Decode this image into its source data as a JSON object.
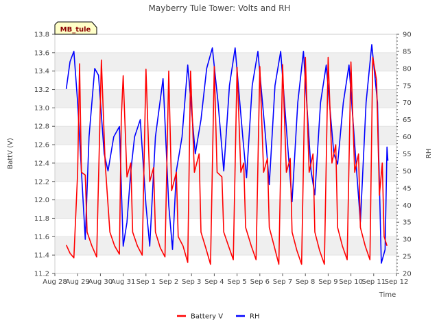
{
  "chart_data": {
    "type": "line",
    "title": "Mayberry Tule Tower: Volts and RH",
    "badge": "MB_tule",
    "xlabel": "Time",
    "ylabel_left": "BattV (V)",
    "ylabel_right": "RH",
    "xlim": [
      "2023-08-28",
      "2023-09-12"
    ],
    "x_tick_labels": [
      "Aug 28",
      "Aug 29",
      "Aug 30",
      "Aug 31",
      "Sep 1",
      "Sep 2",
      "Sep 3",
      "Sep 4",
      "Sep 5",
      "Sep 6",
      "Sep 7",
      "Sep 8",
      "Sep 9",
      "Sep 10",
      "Sep 11",
      "Sep 12"
    ],
    "ylim_left": [
      11.2,
      13.8
    ],
    "y_ticks_left": [
      "11.2",
      "11.4",
      "11.6",
      "11.8",
      "12.0",
      "12.2",
      "12.4",
      "12.6",
      "12.8",
      "13.0",
      "13.2",
      "13.4",
      "13.6",
      "13.8"
    ],
    "ylim_right": [
      20,
      90
    ],
    "y_ticks_right": [
      "20",
      "25",
      "30",
      "35",
      "40",
      "45",
      "50",
      "55",
      "60",
      "65",
      "70",
      "75",
      "80",
      "85",
      "90"
    ],
    "grid": "horizontal bands",
    "legend_position": "bottom-center",
    "series": [
      {
        "name": "Battery V",
        "color": "#ff0000",
        "axis": "left",
        "points": [
          [
            "2023-08-28 12:00",
            11.51
          ],
          [
            "2023-08-28 16:00",
            11.42
          ],
          [
            "2023-08-28 20:00",
            11.37
          ],
          [
            "2023-08-29 00:00",
            12.3
          ],
          [
            "2023-08-29 02:00",
            13.48
          ],
          [
            "2023-08-29 04:00",
            12.3
          ],
          [
            "2023-08-29 08:00",
            12.27
          ],
          [
            "2023-08-29 10:00",
            11.65
          ],
          [
            "2023-08-29 15:00",
            11.5
          ],
          [
            "2023-08-29 20:00",
            11.38
          ],
          [
            "2023-08-29 23:00",
            12.64
          ],
          [
            "2023-08-30 01:00",
            13.52
          ],
          [
            "2023-08-30 05:00",
            12.4
          ],
          [
            "2023-08-30 10:00",
            11.65
          ],
          [
            "2023-08-30 15:00",
            11.5
          ],
          [
            "2023-08-30 20:00",
            11.41
          ],
          [
            "2023-08-30 22:00",
            12.88
          ],
          [
            "2023-08-31 00:00",
            13.35
          ],
          [
            "2023-08-31 04:00",
            12.25
          ],
          [
            "2023-08-31 08:00",
            12.4
          ],
          [
            "2023-08-31 10:00",
            11.65
          ],
          [
            "2023-08-31 15:00",
            11.5
          ],
          [
            "2023-08-31 20:00",
            11.4
          ],
          [
            "2023-09-01 00:00",
            13.42
          ],
          [
            "2023-09-01 04:00",
            12.2
          ],
          [
            "2023-09-01 08:00",
            12.35
          ],
          [
            "2023-09-01 10:00",
            11.65
          ],
          [
            "2023-09-01 15:00",
            11.48
          ],
          [
            "2023-09-01 20:00",
            11.38
          ],
          [
            "2023-09-02 00:00",
            13.4
          ],
          [
            "2023-09-02 03:00",
            12.1
          ],
          [
            "2023-09-02 08:00",
            12.3
          ],
          [
            "2023-09-02 10:00",
            11.6
          ],
          [
            "2023-09-02 15:00",
            11.5
          ],
          [
            "2023-09-02 20:00",
            11.32
          ],
          [
            "2023-09-02 23:00",
            13.4
          ],
          [
            "2023-09-03 03:00",
            12.3
          ],
          [
            "2023-09-03 08:00",
            12.5
          ],
          [
            "2023-09-03 10:00",
            11.65
          ],
          [
            "2023-09-03 15:00",
            11.48
          ],
          [
            "2023-09-03 20:00",
            11.3
          ],
          [
            "2023-09-04 00:00",
            13.45
          ],
          [
            "2023-09-04 03:00",
            12.3
          ],
          [
            "2023-09-04 08:00",
            12.25
          ],
          [
            "2023-09-04 10:00",
            11.65
          ],
          [
            "2023-09-04 15:00",
            11.5
          ],
          [
            "2023-09-04 20:00",
            11.35
          ],
          [
            "2023-09-05 00:00",
            13.44
          ],
          [
            "2023-09-05 04:00",
            12.3
          ],
          [
            "2023-09-05 07:00",
            12.4
          ],
          [
            "2023-09-05 09:00",
            11.7
          ],
          [
            "2023-09-05 15:00",
            11.5
          ],
          [
            "2023-09-05 20:00",
            11.35
          ],
          [
            "2023-09-06 00:00",
            13.45
          ],
          [
            "2023-09-06 04:00",
            12.3
          ],
          [
            "2023-09-06 08:00",
            12.45
          ],
          [
            "2023-09-06 10:00",
            11.7
          ],
          [
            "2023-09-06 15:00",
            11.5
          ],
          [
            "2023-09-06 20:00",
            11.3
          ],
          [
            "2023-09-07 00:00",
            13.47
          ],
          [
            "2023-09-07 04:00",
            12.3
          ],
          [
            "2023-09-07 08:00",
            12.45
          ],
          [
            "2023-09-07 10:00",
            11.65
          ],
          [
            "2023-09-07 15:00",
            11.45
          ],
          [
            "2023-09-07 20:00",
            11.3
          ],
          [
            "2023-09-08 00:00",
            13.55
          ],
          [
            "2023-09-08 04:00",
            12.3
          ],
          [
            "2023-09-08 08:00",
            12.5
          ],
          [
            "2023-09-08 10:00",
            11.65
          ],
          [
            "2023-09-08 15:00",
            11.45
          ],
          [
            "2023-09-08 20:00",
            11.3
          ],
          [
            "2023-09-09 00:00",
            13.55
          ],
          [
            "2023-09-09 04:00",
            12.4
          ],
          [
            "2023-09-09 08:00",
            12.6
          ],
          [
            "2023-09-09 10:00",
            11.7
          ],
          [
            "2023-09-09 15:00",
            11.5
          ],
          [
            "2023-09-09 20:00",
            11.35
          ],
          [
            "2023-09-10 00:00",
            13.5
          ],
          [
            "2023-09-10 04:00",
            12.3
          ],
          [
            "2023-09-10 08:00",
            12.5
          ],
          [
            "2023-09-10 10:00",
            11.7
          ],
          [
            "2023-09-10 15:00",
            11.5
          ],
          [
            "2023-09-10 20:00",
            11.35
          ],
          [
            "2023-09-10 23:00",
            13.55
          ],
          [
            "2023-09-11 03:00",
            13.3
          ],
          [
            "2023-09-11 06:00",
            12.05
          ],
          [
            "2023-09-11 09:00",
            12.4
          ],
          [
            "2023-09-11 11:00",
            11.6
          ],
          [
            "2023-09-11 14:00",
            11.5
          ]
        ]
      },
      {
        "name": "RH",
        "color": "#0000ff",
        "axis": "right",
        "points": [
          [
            "2023-08-28 12:00",
            74
          ],
          [
            "2023-08-28 16:00",
            82
          ],
          [
            "2023-08-28 20:00",
            85
          ],
          [
            "2023-08-29 00:00",
            70
          ],
          [
            "2023-08-29 04:00",
            50
          ],
          [
            "2023-08-29 08:00",
            30
          ],
          [
            "2023-08-29 12:00",
            60
          ],
          [
            "2023-08-29 18:00",
            80
          ],
          [
            "2023-08-29 22:00",
            78
          ],
          [
            "2023-08-30 04:00",
            55
          ],
          [
            "2023-08-30 08:00",
            50
          ],
          [
            "2023-08-30 14:00",
            60
          ],
          [
            "2023-08-30 20:00",
            63
          ],
          [
            "2023-08-31 00:00",
            28
          ],
          [
            "2023-08-31 04:00",
            35
          ],
          [
            "2023-08-31 08:00",
            50
          ],
          [
            "2023-08-31 12:00",
            60
          ],
          [
            "2023-08-31 18:00",
            65
          ],
          [
            "2023-09-01 00:00",
            40
          ],
          [
            "2023-09-01 04:00",
            28
          ],
          [
            "2023-09-01 10:00",
            60
          ],
          [
            "2023-09-01 18:00",
            77
          ],
          [
            "2023-09-02 00:00",
            40
          ],
          [
            "2023-09-02 04:00",
            27
          ],
          [
            "2023-09-02 08:00",
            50
          ],
          [
            "2023-09-02 14:00",
            60
          ],
          [
            "2023-09-02 20:00",
            81
          ],
          [
            "2023-09-03 04:00",
            55
          ],
          [
            "2023-09-03 10:00",
            65
          ],
          [
            "2023-09-03 16:00",
            80
          ],
          [
            "2023-09-03 22:00",
            86
          ],
          [
            "2023-09-04 04:00",
            70
          ],
          [
            "2023-09-04 10:00",
            50
          ],
          [
            "2023-09-04 16:00",
            75
          ],
          [
            "2023-09-04 22:00",
            86
          ],
          [
            "2023-09-05 06:00",
            60
          ],
          [
            "2023-09-05 10:00",
            48
          ],
          [
            "2023-09-05 16:00",
            75
          ],
          [
            "2023-09-05 22:00",
            85
          ],
          [
            "2023-09-06 06:00",
            60
          ],
          [
            "2023-09-06 10:00",
            46
          ],
          [
            "2023-09-06 16:00",
            75
          ],
          [
            "2023-09-06 22:00",
            85
          ],
          [
            "2023-09-07 06:00",
            55
          ],
          [
            "2023-09-07 10:00",
            41
          ],
          [
            "2023-09-07 16:00",
            70
          ],
          [
            "2023-09-07 22:00",
            85
          ],
          [
            "2023-09-08 06:00",
            50
          ],
          [
            "2023-09-08 10:00",
            43
          ],
          [
            "2023-09-08 16:00",
            70
          ],
          [
            "2023-09-08 22:00",
            81
          ],
          [
            "2023-09-09 06:00",
            55
          ],
          [
            "2023-09-09 10:00",
            52
          ],
          [
            "2023-09-09 16:00",
            70
          ],
          [
            "2023-09-09 22:00",
            81
          ],
          [
            "2023-09-10 06:00",
            50
          ],
          [
            "2023-09-10 10:00",
            35
          ],
          [
            "2023-09-10 16:00",
            70
          ],
          [
            "2023-09-10 22:00",
            87
          ],
          [
            "2023-09-11 04:00",
            70
          ],
          [
            "2023-09-11 08:00",
            23
          ],
          [
            "2023-09-11 12:00",
            27
          ],
          [
            "2023-09-11 14:00",
            57
          ],
          [
            "2023-09-11 15:00",
            53
          ]
        ]
      }
    ]
  }
}
